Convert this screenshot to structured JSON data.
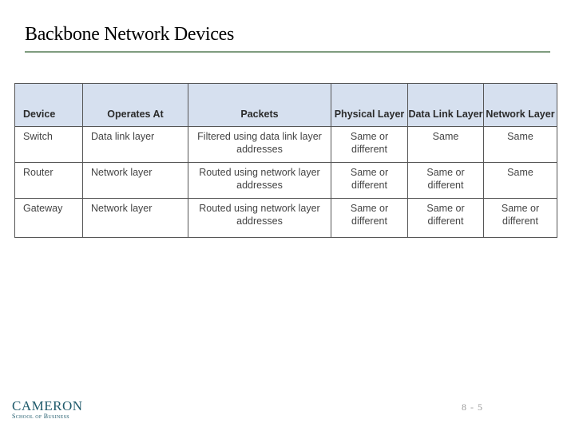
{
  "slide": {
    "title": "Backbone Network Devices",
    "page_number": "8 - 5"
  },
  "table": {
    "headers": [
      "Device",
      "Operates At",
      "Packets",
      "Physical Layer",
      "Data Link Layer",
      "Network Layer"
    ],
    "rows": [
      [
        "Switch",
        "Data link layer",
        "Filtered using data link layer addresses",
        "Same or different",
        "Same",
        "Same"
      ],
      [
        "Router",
        "Network layer",
        "Routed using network layer addresses",
        "Same or different",
        "Same or different",
        "Same"
      ],
      [
        "Gateway",
        "Network layer",
        "Routed using network layer addresses",
        "Same or different",
        "Same or different",
        "Same or different"
      ]
    ]
  },
  "logo": {
    "name": "CAMERON",
    "subtitle": "School of Business"
  },
  "colors": {
    "title_rule": "#7f9c7f",
    "header_bg": "#d6e0ef",
    "logo": "#1f5a6b"
  }
}
